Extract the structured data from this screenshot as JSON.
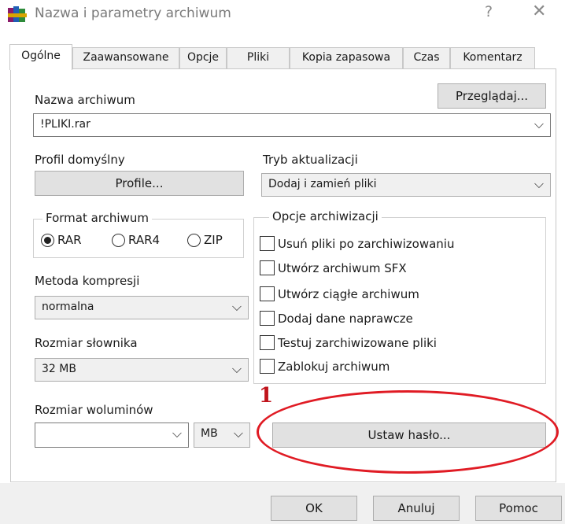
{
  "window": {
    "title": "Nazwa i parametry archiwum",
    "help_glyph": "?",
    "close_glyph": "✕"
  },
  "tabs": [
    {
      "label": "Ogólne",
      "active": true
    },
    {
      "label": "Zaawansowane"
    },
    {
      "label": "Opcje"
    },
    {
      "label": "Pliki"
    },
    {
      "label": "Kopia zapasowa"
    },
    {
      "label": "Czas"
    },
    {
      "label": "Komentarz"
    }
  ],
  "general": {
    "archive_name_label": "Nazwa archiwum",
    "browse_button": "Przeglądaj...",
    "archive_name_value": "!PLIKI.rar",
    "default_profile_label": "Profil domyślny",
    "profiles_button": "Profile...",
    "update_mode_label": "Tryb aktualizacji",
    "update_mode_value": "Dodaj i zamień pliki",
    "archive_format": {
      "title": "Format archiwum",
      "options": [
        "RAR",
        "RAR4",
        "ZIP"
      ],
      "selected": "RAR"
    },
    "compression_method_label": "Metoda kompresji",
    "compression_method_value": "normalna",
    "dictionary_size_label": "Rozmiar słownika",
    "dictionary_size_value": "32 MB",
    "volume_size_label": "Rozmiar woluminów",
    "volume_size_value": "",
    "volume_unit_value": "MB",
    "archiving_options": {
      "title": "Opcje archiwizacji",
      "items": [
        {
          "label": "Usuń pliki po zarchiwizowaniu",
          "checked": false
        },
        {
          "label": "Utwórz archiwum SFX",
          "checked": false
        },
        {
          "label": "Utwórz ciągłe archiwum",
          "checked": false
        },
        {
          "label": "Dodaj dane naprawcze",
          "checked": false
        },
        {
          "label": "Testuj zarchiwizowane pliki",
          "checked": false
        },
        {
          "label": "Zablokuj archiwum",
          "checked": false
        }
      ]
    },
    "set_password_button": "Ustaw hasło..."
  },
  "annotation": {
    "number": "1",
    "color": "#e01b24"
  },
  "footer": {
    "ok_button": "OK",
    "cancel_button": "Anuluj",
    "help_button": "Pomoc"
  },
  "icons": {
    "app": "winrar-books-icon",
    "dropdown": "chevron-down-icon"
  }
}
